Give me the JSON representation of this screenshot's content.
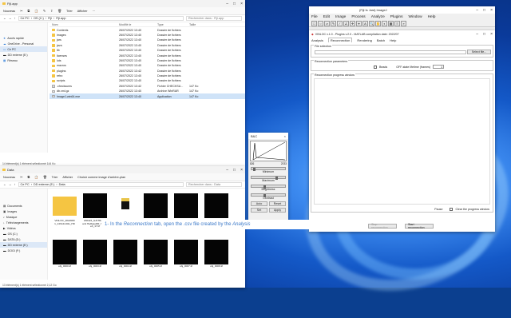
{
  "top_explorer": {
    "title": "Fiji.app",
    "toolbar": {
      "new_label": "Nouveau",
      "sort_label": "Trier",
      "view_label": "Afficher"
    },
    "breadcrumb": [
      "Ce PC",
      "OS (C:)",
      "Fiji",
      "Fiji.app"
    ],
    "search_placeholder": "Rechercher dans : Fiji.app",
    "sidebar": [
      "Accès rapide",
      "OneDrive - Personal",
      "Ce PC",
      "DD externe (E:)",
      "Réseau"
    ],
    "columns": [
      "Nom",
      "Modifié le",
      "Type",
      "Taille"
    ],
    "files": [
      {
        "name": "Contents",
        "date": "26/07/2022 13:40",
        "type": "Dossier de fichiers",
        "size": "",
        "kind": "folder"
      },
      {
        "name": "images",
        "date": "26/07/2022 13:40",
        "type": "Dossier de fichiers",
        "size": "",
        "kind": "folder"
      },
      {
        "name": "jars",
        "date": "26/07/2022 13:40",
        "type": "Dossier de fichiers",
        "size": "",
        "kind": "folder"
      },
      {
        "name": "java",
        "date": "26/07/2022 13:40",
        "type": "Dossier de fichiers",
        "size": "",
        "kind": "folder"
      },
      {
        "name": "lib",
        "date": "26/07/2022 13:40",
        "type": "Dossier de fichiers",
        "size": "",
        "kind": "folder"
      },
      {
        "name": "licenses",
        "date": "26/07/2022 13:40",
        "type": "Dossier de fichiers",
        "size": "",
        "kind": "folder"
      },
      {
        "name": "luts",
        "date": "26/07/2022 13:40",
        "type": "Dossier de fichiers",
        "size": "",
        "kind": "folder"
      },
      {
        "name": "macros",
        "date": "26/07/2022 13:40",
        "type": "Dossier de fichiers",
        "size": "",
        "kind": "folder"
      },
      {
        "name": "plugins",
        "date": "26/07/2022 13:42",
        "type": "Dossier de fichiers",
        "size": "",
        "kind": "folder"
      },
      {
        "name": "retro",
        "date": "26/07/2022 13:40",
        "type": "Dossier de fichiers",
        "size": "",
        "kind": "folder"
      },
      {
        "name": "scripts",
        "date": "26/07/2022 13:40",
        "type": "Dossier de fichiers",
        "size": "",
        "kind": "folder"
      },
      {
        "name": ".checksums",
        "date": "26/07/2022 13:42",
        "type": "Fichier CHECKSU...",
        "size": "147 Ko",
        "kind": "file"
      },
      {
        "name": "db.xml.gz",
        "date": "26/07/2022 13:40",
        "type": "Archive WinRAR",
        "size": "147 Ko",
        "kind": "file"
      },
      {
        "name": "ImageJ-win64.exe",
        "date": "26/07/2022 13:40",
        "type": "Application",
        "size": "147 Ko",
        "kind": "exe"
      }
    ],
    "status": "14 élément(s)   1 élément sélectionné  144 Ko"
  },
  "bottom_explorer": {
    "title": "Data",
    "toolbar": {
      "new_label": "Nouveau",
      "sort_label": "Trier",
      "view_label": "Afficher",
      "extra_label": "Choisir comme image d'arrière-plan"
    },
    "breadcrumb": [
      "Ce PC",
      "DD externe (E:)",
      "Data"
    ],
    "search_placeholder": "Rechercher dans : Data",
    "sidebar": [
      "Documents",
      "Images",
      "Musique",
      "Téléchargements",
      "Vidéos",
      "OS (C:)",
      "DATA (D:)",
      "DD externe (E:)",
      "DOGI (F:)"
    ],
    "thumbs_row1": [
      {
        "caption": "VINLOC_2022080 1_14h14m04s_HD",
        "kind": "folder"
      },
      {
        "caption": "180424_GAITRADip aml HalfwayDR_Sampl e3_17.tif",
        "kind": "image"
      },
      {
        "caption": "",
        "kind": "app"
      },
      {
        "caption": "",
        "kind": "image"
      },
      {
        "caption": "",
        "kind": "image"
      },
      {
        "caption": "",
        "kind": "image"
      }
    ],
    "thumbs_row2": [
      {
        "caption": "obj_0000.tif"
      },
      {
        "caption": "obj_0003.tif"
      },
      {
        "caption": "obj_0004.tif"
      },
      {
        "caption": "obj_0005.tif"
      },
      {
        "caption": "obj_0007.tif"
      },
      {
        "caption": "obj_0008.tif"
      }
    ],
    "status": "13 élément(s)   1 élément sélectionné  2,12 Go"
  },
  "imagej": {
    "title": "(Fiji Is Just) ImageJ",
    "menu": [
      "File",
      "Edit",
      "Image",
      "Process",
      "Analyze",
      "Plugins",
      "Window",
      "Help"
    ],
    "tools": [
      "□",
      "○",
      "▱",
      "✎",
      "∕",
      "∠",
      "✛",
      "⌖",
      "A",
      "🔍",
      "✋",
      "◐",
      "▦",
      "≡",
      "»"
    ]
  },
  "vinloc": {
    "title": "VINLOC v.1.0 - Plugins v.2.0 - MATLAB compilation date: 2022/07",
    "menu": [
      "Analysis",
      "Reconnection",
      "Rendering",
      "Batch",
      "Help"
    ],
    "active_tab": "Reconnection",
    "file_selection_legend": "File selection",
    "file_button": "Select file...",
    "params_legend": "Reconnection parameters",
    "beads_label": "Beads",
    "off_state_label": "OFF-state lifetime (frames)",
    "off_state_value": "1",
    "progress_legend": "Reconnection progress window",
    "pause_label": "Pause",
    "clear_label": "Clear the progress window",
    "stop_button": "Stop reconnection",
    "start_button": "Start reconnection"
  },
  "bc": {
    "title": "B&C",
    "range_min": "826",
    "range_max": "2033",
    "labels": [
      "Minimum",
      "Maximum",
      "Brightness",
      "Contrast"
    ],
    "buttons": [
      "Auto",
      "Reset",
      "Set",
      "Apply"
    ]
  },
  "caption": {
    "prefix": "1- In the ",
    "tab": "Reconnection",
    "middle": " tab, open the .csv file created by the ",
    "analysis": "Analysis"
  },
  "colors": {
    "caption_text": "#3a78c8",
    "selection": "#cfe3f8",
    "folder": "#f5c542"
  }
}
